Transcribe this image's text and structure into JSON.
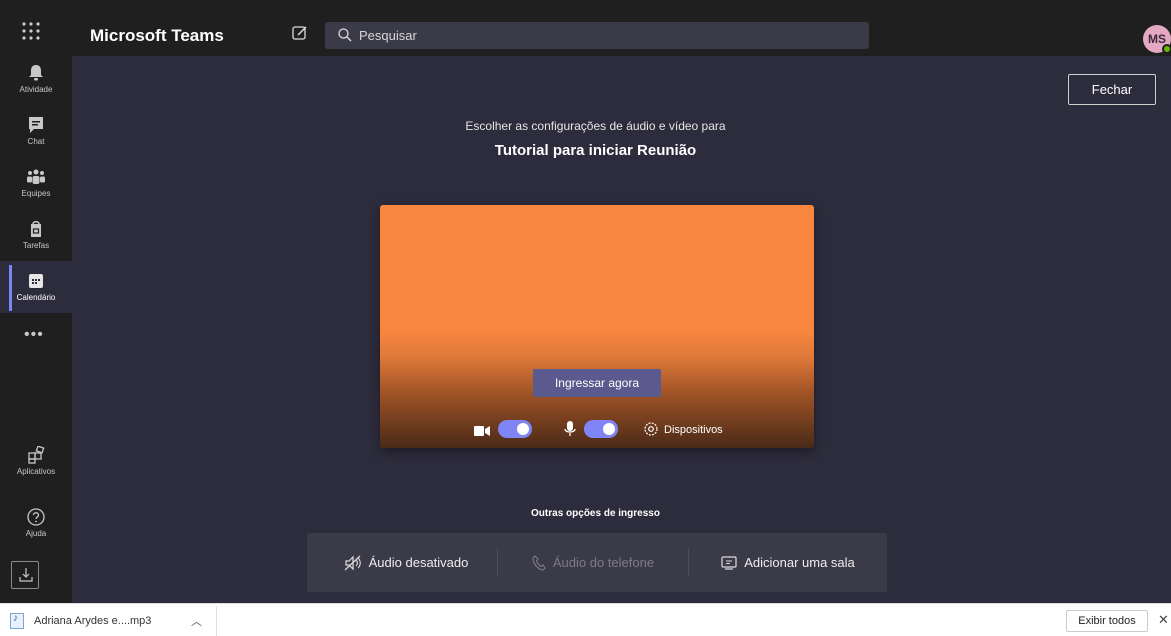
{
  "topbar": {
    "app_title": "Microsoft Teams",
    "search_placeholder": "Pesquisar",
    "avatar_initials": "MS",
    "presence_color": "#6bb700"
  },
  "rail": {
    "items": [
      {
        "label": "Atividade",
        "icon": "bell-icon"
      },
      {
        "label": "Chat",
        "icon": "chat-icon"
      },
      {
        "label": "Equipes",
        "icon": "teams-icon"
      },
      {
        "label": "Tarefas",
        "icon": "tasks-icon"
      },
      {
        "label": "Calendário",
        "icon": "calendar-icon",
        "active": true
      }
    ],
    "more": "•••",
    "bottom_items": [
      {
        "label": "Aplicativos",
        "icon": "apps-icon"
      },
      {
        "label": "Ajuda",
        "icon": "help-icon"
      }
    ],
    "accent_color": "#7f85f5"
  },
  "prejoin": {
    "close_label": "Fechar",
    "subtitle": "Escolher as configurações de áudio e vídeo para",
    "meeting_title": "Tutorial para iniciar Reunião",
    "join_label": "Ingressar agora",
    "camera_on": true,
    "mic_on": true,
    "devices_label": "Dispositivos",
    "preview_color": "#f8863f"
  },
  "other_options": {
    "title": "Outras opções de ingresso",
    "audio_off": "Áudio desativado",
    "phone_audio": "Áudio do telefone",
    "add_room": "Adicionar uma sala"
  },
  "download_bar": {
    "file_name": "Adriana Arydes e....mp3",
    "show_all": "Exibir todos",
    "close": "✕"
  }
}
